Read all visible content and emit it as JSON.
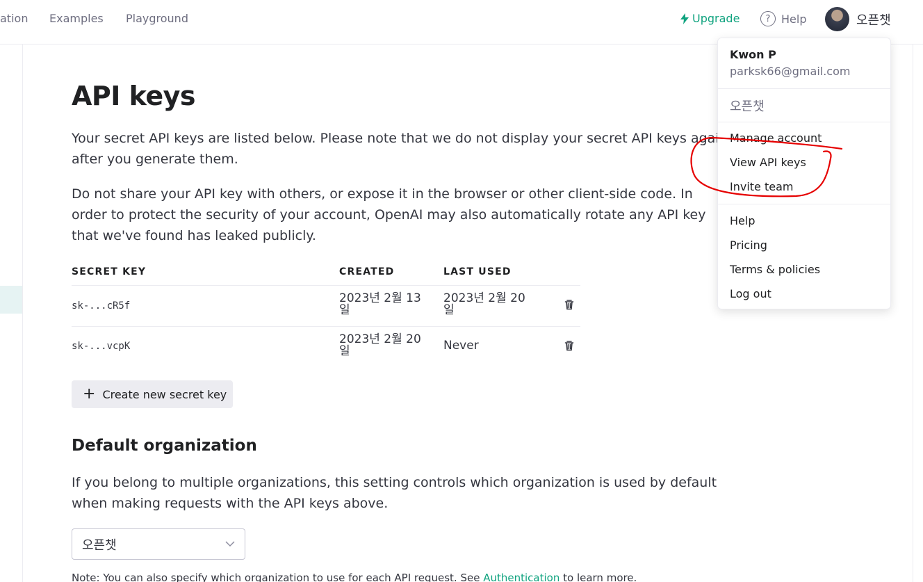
{
  "nav": {
    "links": [
      "ation",
      "Examples",
      "Playground"
    ],
    "upgrade": "Upgrade",
    "help": "Help",
    "org": "오픈챗",
    "accent": "#10a37f"
  },
  "page": {
    "title": "API keys",
    "intro1": "Your secret API keys are listed below. Please note that we do not display your secret API keys again after you generate them.",
    "intro2": "Do not share your API key with others, or expose it in the browser or other client-side code. In order to protect the security of your account, OpenAI may also automatically rotate any API key that we've found has leaked publicly."
  },
  "table": {
    "headers": [
      "SECRET KEY",
      "CREATED",
      "LAST USED"
    ],
    "rows": [
      {
        "key": "sk-...cR5f",
        "created": "2023년 2월 13일",
        "last_used": "2023년 2월 20일"
      },
      {
        "key": "sk-...vcpK",
        "created": "2023년 2월 20일",
        "last_used": "Never"
      }
    ]
  },
  "create_button": "Create new secret key",
  "default_org": {
    "heading": "Default organization",
    "description": "If you belong to multiple organizations, this setting controls which organization is used by default when making requests with the API keys above.",
    "selected": "오픈챗",
    "note_prefix": "Note: You can also specify which organization to use for each API request. See ",
    "note_link": "Authentication",
    "note_suffix": " to learn more."
  },
  "menu": {
    "name": "Kwon P",
    "email": "parksk66@gmail.com",
    "org": "오픈챗",
    "account_items": [
      "Manage account",
      "View API keys",
      "Invite team"
    ],
    "footer_items": [
      "Help",
      "Pricing",
      "Terms & policies",
      "Log out"
    ]
  },
  "icons": {
    "upgrade": "lightning-icon",
    "help": "question-circle-icon",
    "delete": "trash-icon",
    "add": "plus-icon",
    "select": "chevron-down-icon"
  }
}
